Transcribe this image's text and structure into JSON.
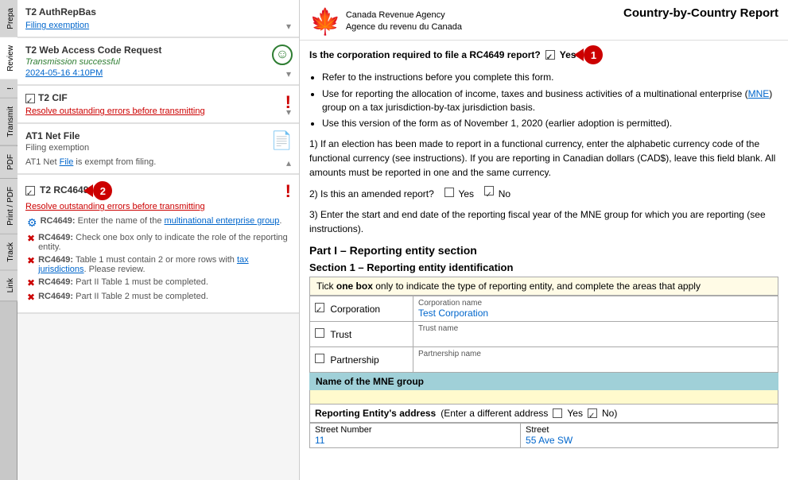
{
  "sidebar": {
    "tabs": [
      "Prepa",
      "Review",
      "!",
      "Transmit",
      "PDF",
      "Print / PDF",
      "Track",
      "Link"
    ]
  },
  "left_panel": {
    "items": [
      {
        "id": "filing-exemption",
        "title": "T2 AuthRepBas",
        "subtitle": "Filing exemption",
        "status": "link",
        "chevron": "down"
      },
      {
        "id": "web-access",
        "title": "T2 Web Access Code Request",
        "subtitle": "Transmission successful",
        "timestamp": "2024-05-16 4:10PM",
        "status": "success",
        "chevron": "down"
      },
      {
        "id": "t2-cif",
        "title": "T2 CIF",
        "subtitle": "Resolve outstanding errors before transmitting",
        "status": "error",
        "chevron": "down"
      },
      {
        "id": "at1-net",
        "title": "AT1 Net File",
        "subtitle": "Filing exemption",
        "status": "document",
        "chevron": "up",
        "exempt_text": "AT1 Net File is exempt from filing."
      },
      {
        "id": "t2-rc4649",
        "title": "T2 RC4649",
        "badge": "2",
        "subtitle": "Resolve outstanding errors before transmitting",
        "status": "error",
        "chevron": "none",
        "errors": [
          {
            "icon": "info",
            "text": "RC4649: Enter the name of the multinational enterprise group."
          },
          {
            "icon": "x",
            "text": "RC4649: Check one box only to indicate the role of the reporting entity."
          },
          {
            "icon": "x",
            "text": "RC4649: Table 1 must contain 2 or more rows with tax jurisdictions. Please review."
          },
          {
            "icon": "x",
            "text": "RC4649: Part II Table 1 must be completed."
          },
          {
            "icon": "x",
            "text": "RC4649: Part II Table 2 must be completed."
          }
        ]
      }
    ]
  },
  "form": {
    "agency_en": "Canada Revenue Agency",
    "agency_fr": "Agence du revenu du Canada",
    "title": "Country-by-Country Report",
    "question1": "Is the corporation required to file a RC4649 report?",
    "yes_label": "Yes",
    "no_label": "No",
    "bullet1": "Refer to the instructions before you complete this form.",
    "bullet2": "Use for reporting the allocation of income, taxes and business activities of a multinational enterprise (MNE) group on a tax jurisdiction-by-tax jurisdiction basis.",
    "bullet3": "Use this version of the form as of November 1, 2020 (earlier adoption is permitted).",
    "item1": "1)  If an election has been made to report in a functional currency, enter the alphabetic currency code of the functional currency (see instructions). If you are reporting in Canadian dollars (CAD$), leave this field blank. All amounts must be reported in one and the same currency.",
    "item2": "2)  Is this an amended report?",
    "item3_label": "3)  Enter the start and end date of the reporting fiscal year of the MNE group for which you are reporting (see instructions).",
    "part1_title": "Part I – Reporting entity section",
    "section1_title": "Section 1 – Reporting entity identification",
    "table_notice": "Tick one box only to indicate the type of reporting entity, and complete the areas that apply",
    "entity_types": [
      {
        "label": "Corporation",
        "checked": true,
        "name_label": "Corporation name",
        "name_value": "Test Corporation"
      },
      {
        "label": "Trust",
        "checked": false,
        "name_label": "Trust name",
        "name_value": ""
      },
      {
        "label": "Partnership",
        "checked": false,
        "name_label": "Partnership name",
        "name_value": ""
      }
    ],
    "mne_group_label": "Name of the MNE group",
    "address_label": "Reporting Entity's address",
    "address_sub": "(Enter a different address",
    "street_number_label": "Street Number",
    "street_number_value": "11",
    "street_label": "Street",
    "street_value": "55 Ave SW"
  }
}
